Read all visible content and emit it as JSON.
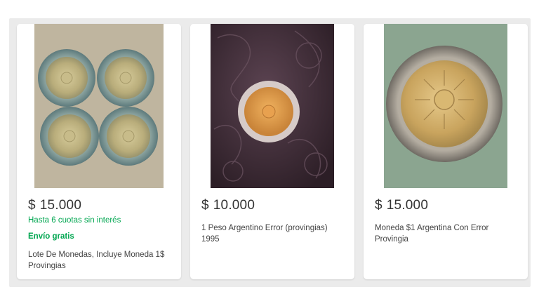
{
  "listings": [
    {
      "price_currency": "$",
      "price_amount": "15.000",
      "installments": "Hasta 6 cuotas sin interés",
      "shipping": "Envío gratis",
      "title": "Lote De Monedas, Incluye Moneda 1$ Provingias",
      "image": "four-coins-photo"
    },
    {
      "price_currency": "$",
      "price_amount": "10.000",
      "title": "1 Peso Argentino Error (provingias) 1995",
      "image": "coin-on-leather-photo"
    },
    {
      "price_currency": "$",
      "price_amount": "15.000",
      "title": "Moneda $1 Argentina Con Error Provingia",
      "image": "single-coin-closeup-photo"
    }
  ],
  "colors": {
    "background_panel": "#ebebeb",
    "price_text": "#333333",
    "green_promo": "#00a650",
    "title_text": "#444444"
  }
}
